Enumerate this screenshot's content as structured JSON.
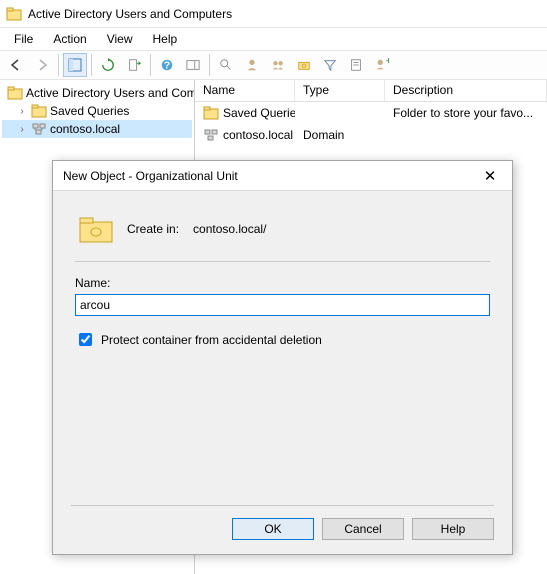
{
  "window": {
    "title": "Active Directory Users and Computers"
  },
  "menu": {
    "file": "File",
    "action": "Action",
    "view": "View",
    "help": "Help"
  },
  "tree": {
    "root": "Active Directory Users and Com",
    "saved_queries": "Saved Queries",
    "domain": "contoso.local"
  },
  "list": {
    "cols": {
      "name": "Name",
      "type": "Type",
      "desc": "Description"
    },
    "rows": [
      {
        "name": "Saved Queries",
        "type": "",
        "desc": "Folder to store your favo..."
      },
      {
        "name": "contoso.local",
        "type": "Domain",
        "desc": ""
      }
    ]
  },
  "dialog": {
    "title": "New Object - Organizational Unit",
    "create_in_label": "Create in:",
    "create_in_path": "contoso.local/",
    "name_label": "Name:",
    "name_value": "arcou",
    "protect_label": "Protect container from accidental deletion",
    "ok": "OK",
    "cancel": "Cancel",
    "help": "Help"
  }
}
